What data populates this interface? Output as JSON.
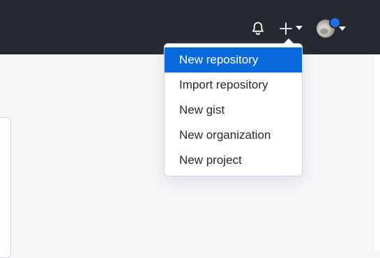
{
  "header": {
    "notifications_icon": "bell-icon",
    "create_icon": "plus-icon",
    "create_caret_icon": "triangle-down-icon",
    "avatar_icon": "avatar",
    "avatar_caret_icon": "triangle-down-icon",
    "notification_dot_color": "#1f6feb"
  },
  "create_menu": {
    "items": [
      {
        "label": "New repository",
        "active": true
      },
      {
        "label": "Import repository",
        "active": false
      },
      {
        "label": "New gist",
        "active": false
      },
      {
        "label": "New organization",
        "active": false
      },
      {
        "label": "New project",
        "active": false
      }
    ]
  },
  "colors": {
    "header_bg": "#24292f",
    "active_item_bg": "#0969da",
    "page_bg": "#f6f8fa"
  }
}
